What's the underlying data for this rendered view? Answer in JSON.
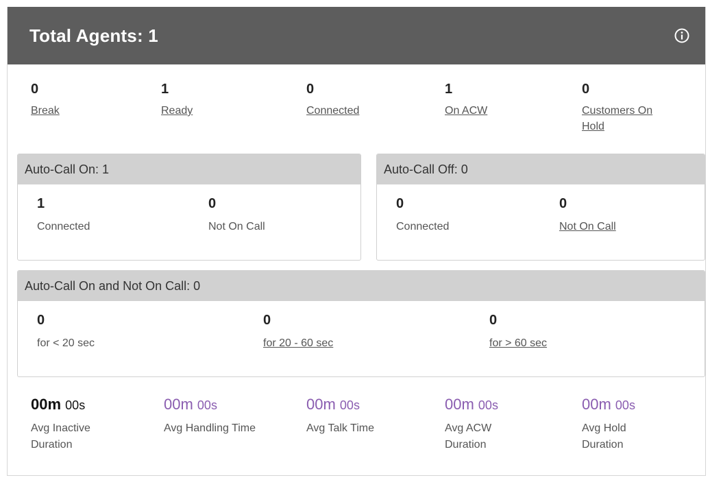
{
  "header": {
    "title": "Total Agents: 1",
    "info_icon": "info-circle-icon"
  },
  "summary": [
    {
      "value": "0",
      "label": "Break"
    },
    {
      "value": "1",
      "label": "Ready"
    },
    {
      "value": "0",
      "label": "Connected"
    },
    {
      "value": "1",
      "label": "On ACW"
    },
    {
      "value": "0",
      "label": "Customers On Hold"
    }
  ],
  "auto_on": {
    "title": "Auto-Call On: 1",
    "connected": {
      "value": "1",
      "label": "Connected"
    },
    "not_on_call": {
      "value": "0",
      "label": "Not On Call"
    }
  },
  "auto_off": {
    "title": "Auto-Call Off: 0",
    "connected": {
      "value": "0",
      "label": "Connected"
    },
    "not_on_call": {
      "value": "0",
      "label": "Not On Call"
    }
  },
  "auto_on_not_on_call": {
    "title": "Auto-Call On and Not On Call: 0",
    "items": [
      {
        "value": "0",
        "label": "for < 20 sec"
      },
      {
        "value": "0",
        "label": "for 20 - 60 sec"
      },
      {
        "value": "0",
        "label": "for > 60 sec"
      }
    ]
  },
  "metrics": [
    {
      "m": "00m",
      "s": "00s",
      "label": "Avg Inactive Duration"
    },
    {
      "m": "00m",
      "s": "00s",
      "label": "Avg Handling Time"
    },
    {
      "m": "00m",
      "s": "00s",
      "label": "Avg Talk Time"
    },
    {
      "m": "00m",
      "s": "00s",
      "label": "Avg ACW Duration"
    },
    {
      "m": "00m",
      "s": "00s",
      "label": "Avg Hold Duration"
    }
  ],
  "colors": {
    "header_bg": "#5d5d5d",
    "box_head_bg": "#d1d1d1",
    "accent_purple": "#8a5db0"
  }
}
